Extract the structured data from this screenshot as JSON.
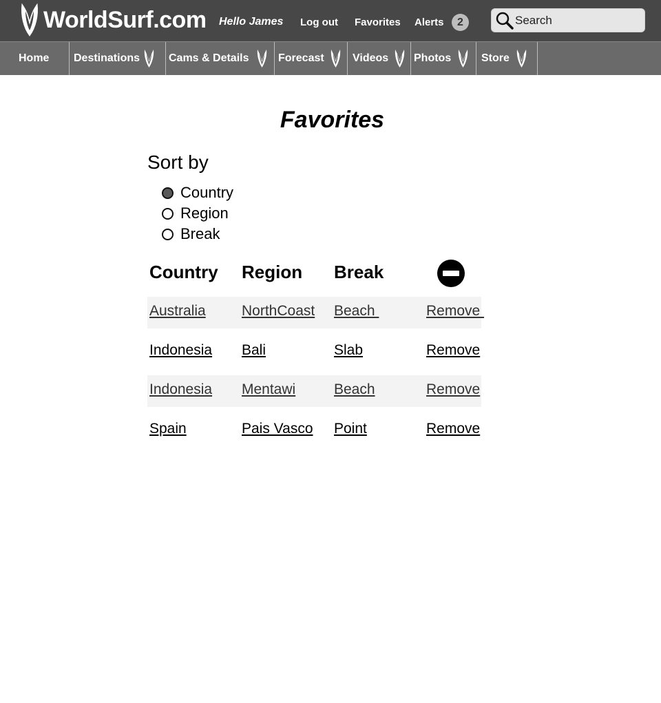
{
  "header": {
    "logo_text": "WorldSurf.com",
    "greeting": "Hello James",
    "logout_label": "Log out",
    "favorites_label": "Favorites",
    "alerts_label": "Alerts",
    "alerts_count": "2",
    "search_placeholder": "Search",
    "bar_color": "#474747"
  },
  "nav": {
    "items": [
      {
        "label": "Home"
      },
      {
        "label": "Destinations"
      },
      {
        "label": "Cams & Details"
      },
      {
        "label": "Forecast"
      },
      {
        "label": "Videos"
      },
      {
        "label": "Photos"
      },
      {
        "label": "Store"
      }
    ],
    "bar_color": "#6a6a6a"
  },
  "page": {
    "title": "Favorites",
    "sort_label": "Sort by",
    "sort_options": [
      {
        "label": "Country",
        "checked": true
      },
      {
        "label": "Region",
        "checked": false
      },
      {
        "label": "Break",
        "checked": false
      }
    ]
  },
  "table": {
    "headers": {
      "country": "Country",
      "region": "Region",
      "break": "Break",
      "remove_icon": "no-entry-icon"
    },
    "rows": [
      {
        "country": "Australia",
        "region": "NorthCoast",
        "break": "Beach ",
        "action": "Remove "
      },
      {
        "country": "Indonesia",
        "region": "Bali",
        "break": "Slab",
        "action": "Remove"
      },
      {
        "country": "Indonesia",
        "region": "Mentawi",
        "break": "Beach",
        "action": "Remove"
      },
      {
        "country": "Spain",
        "region": "Pais Vasco",
        "break": "Point",
        "action": "Remove"
      }
    ],
    "striped_row_color": "#f3f3f3"
  }
}
